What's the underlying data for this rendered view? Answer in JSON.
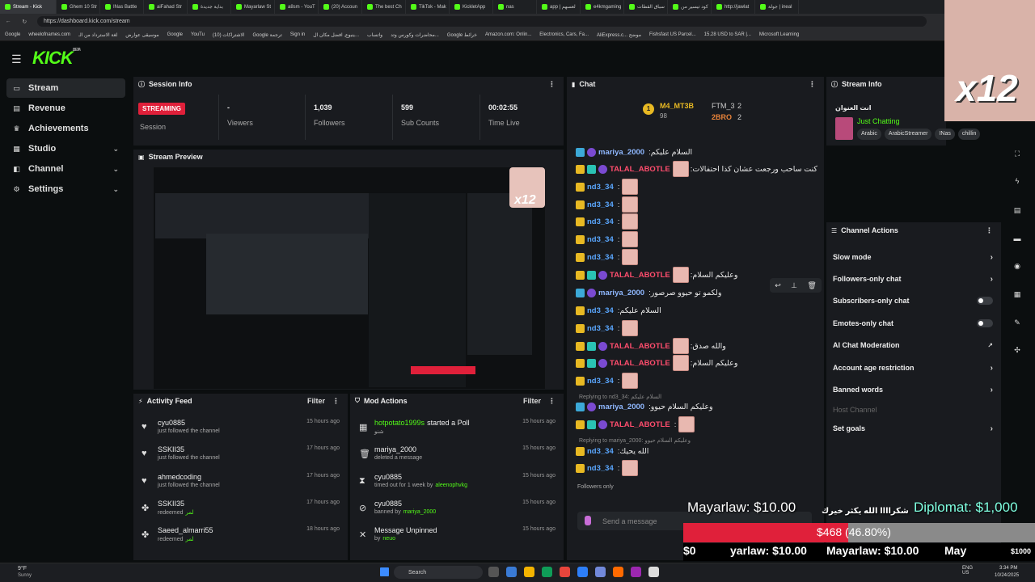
{
  "browser": {
    "tabs": [
      "Stream - Kick",
      "Ghem 10 Str",
      "INas Battle",
      "aiFahad Str",
      "بداية جديدة",
      "Mayarlaw St",
      "a8sm - YouT",
      "(20) Accoun",
      "The best Ch",
      "TikTok - Mak",
      "KickletApp",
      "nas",
      "app | لعسهم",
      "e4kmgaming",
      "سباق القطات",
      "كود تيسير من",
      "http://jawlat",
      "جولة | ineal"
    ],
    "url": "https://dashboard.kick.com/stream",
    "bookmarks": [
      "Google",
      "wheelofnames.com",
      "لغة الاسترداد من الـ",
      "موسيقى عوارض",
      "Google",
      "YouTu",
      "الاشتراكات (10)",
      "Google ترجمة",
      "Sign in",
      "ينبوع, افضل مكان ال...",
      "واتساب",
      "محاضرات وكورس وتد...",
      "Google خرائط",
      "Amazon.com: Onlin...",
      "Electronics, Cars, Fa...",
      "AliExpress.c... موضح",
      "Fishsfast US Parcel...",
      "15.28 USD to SAR |...",
      "Microsoft Learning"
    ]
  },
  "brand": {
    "logo": "KICK",
    "beta": "BETA"
  },
  "sidebar": {
    "items": [
      {
        "label": "Stream",
        "icon": "stream-icon"
      },
      {
        "label": "Revenue",
        "icon": "revenue-icon"
      },
      {
        "label": "Achievements",
        "icon": "trophy-icon"
      },
      {
        "label": "Studio",
        "icon": "studio-icon"
      },
      {
        "label": "Channel",
        "icon": "channel-icon"
      },
      {
        "label": "Settings",
        "icon": "gear-icon"
      }
    ]
  },
  "session": {
    "title": "Session Info",
    "status": "STREAMING",
    "status_label": "Session",
    "viewers": "-",
    "viewers_label": "Viewers",
    "followers": "1,039",
    "followers_label": "Followers",
    "subs": "599",
    "subs_label": "Sub Counts",
    "time": "00:02:55",
    "time_label": "Time Live"
  },
  "preview": {
    "title": "Stream Preview"
  },
  "activity": {
    "title": "Activity Feed",
    "filter": "Filter",
    "rows": [
      {
        "name": "cyu0885",
        "sub": "just followed the channel",
        "time": "15 hours ago",
        "icon": "heart-icon"
      },
      {
        "name": "SSKII35",
        "sub": "just followed the channel",
        "time": "17 hours ago",
        "icon": "heart-icon"
      },
      {
        "name": "ahmedcoding",
        "sub": "just followed the channel",
        "time": "17 hours ago",
        "icon": "heart-icon"
      },
      {
        "name": "SSKII35",
        "sub": "redeemed",
        "sub_extra": "لمر",
        "time": "17 hours ago",
        "icon": "redeem-icon"
      },
      {
        "name": "Saeed_almarri55",
        "sub": "redeemed",
        "sub_extra": "لمر",
        "time": "18 hours ago",
        "icon": "redeem-icon"
      }
    ]
  },
  "mod": {
    "title": "Mod Actions",
    "filter": "Filter",
    "rows": [
      {
        "name": "hotpotato1999s",
        "action": "started a Poll",
        "sub": "شنو",
        "time": "15 hours ago",
        "icon": "poll-icon"
      },
      {
        "name": "mariya_2000",
        "action": "",
        "sub": "deleted a message",
        "time": "15 hours ago",
        "icon": "trash-icon"
      },
      {
        "name": "cyu0885",
        "action": "",
        "sub": "timed out for 1 week by",
        "by": "aleenophvkg",
        "time": "15 hours ago",
        "icon": "hourglass-icon"
      },
      {
        "name": "cyu0885",
        "action": "",
        "sub": "banned by",
        "by": "mariya_2000",
        "time": "15 hours ago",
        "icon": "ban-icon"
      },
      {
        "name": "Message Unpinned",
        "action": "",
        "sub": "by",
        "by": "neuo",
        "time": "15 hours ago",
        "icon": "unpin-icon"
      }
    ]
  },
  "chat": {
    "title": "Chat",
    "top_gifters": [
      {
        "name": "M4_MT3B",
        "count": "98",
        "color": "#e8b923"
      },
      {
        "name": "FTM_3",
        "count": "2",
        "color": "#ccc"
      },
      {
        "name": "2BRO",
        "count": "2",
        "color": "#e8833a"
      }
    ],
    "messages": [
      {
        "user": "mariya_2000",
        "color": "#8fb8ff",
        "badges": [
          "bblue",
          "bpurp"
        ],
        "text": ":السلام عليكم",
        "emote": false
      },
      {
        "user": "TALAL_ABOTLE",
        "color": "#ff4d6d",
        "badges": [
          "bcrown",
          "bteal",
          "bpurp"
        ],
        "text": ":كنت ساحب ورجعت عشان كذا احتفالات",
        "emote": true
      },
      {
        "user": "nd3_34",
        "color": "#5aa7ff",
        "badges": [
          "bcrown"
        ],
        "text": ":",
        "emote": true
      },
      {
        "user": "nd3_34",
        "color": "#5aa7ff",
        "badges": [
          "bcrown"
        ],
        "text": ":",
        "emote": true
      },
      {
        "user": "nd3_34",
        "color": "#5aa7ff",
        "badges": [
          "bcrown"
        ],
        "text": ":",
        "emote": true
      },
      {
        "user": "nd3_34",
        "color": "#5aa7ff",
        "badges": [
          "bcrown"
        ],
        "text": ":",
        "emote": true
      },
      {
        "user": "nd3_34",
        "color": "#5aa7ff",
        "badges": [
          "bcrown"
        ],
        "text": ":",
        "emote": true
      },
      {
        "user": "TALAL_ABOTLE",
        "color": "#ff4d6d",
        "badges": [
          "bcrown",
          "bteal",
          "bpurp"
        ],
        "text": ":وعليكم السلام",
        "emote": true
      },
      {
        "user": "mariya_2000",
        "color": "#8fb8ff",
        "badges": [
          "bblue",
          "bpurp"
        ],
        "text": ":ولكمو تو حيوو صرصور",
        "emote": false
      },
      {
        "user": "nd3_34",
        "color": "#5aa7ff",
        "badges": [
          "bcrown"
        ],
        "text": ":السلام عليكم",
        "emote": false
      },
      {
        "user": "nd3_34",
        "color": "#5aa7ff",
        "badges": [
          "bcrown"
        ],
        "text": ":",
        "emote": true
      },
      {
        "user": "TALAL_ABOTLE",
        "color": "#ff4d6d",
        "badges": [
          "bcrown",
          "bteal",
          "bpurp"
        ],
        "text": ":والله صدق",
        "emote": true
      },
      {
        "user": "TALAL_ABOTLE",
        "color": "#ff4d6d",
        "badges": [
          "bcrown",
          "bteal",
          "bpurp"
        ],
        "text": ":وعليكم السلام",
        "emote": true
      },
      {
        "user": "nd3_34",
        "color": "#5aa7ff",
        "badges": [
          "bcrown"
        ],
        "text": ":",
        "emote": true
      },
      {
        "user": "mariya_2000",
        "color": "#8fb8ff",
        "badges": [
          "bblue",
          "bpurp"
        ],
        "text": ":وعليكم السلام حيوو",
        "emote": false
      },
      {
        "user": "TALAL_ABOTLE",
        "color": "#ff4d6d",
        "badges": [
          "bcrown",
          "bteal",
          "bpurp"
        ],
        "text": ":",
        "emote": true
      },
      {
        "user": "nd3_34",
        "color": "#5aa7ff",
        "badges": [
          "bcrown"
        ],
        "text": ":الله يحيك",
        "emote": false
      },
      {
        "user": "nd3_34",
        "color": "#5aa7ff",
        "badges": [
          "bcrown"
        ],
        "text": ":",
        "emote": true
      }
    ],
    "replies": [
      "Replying to nd3_34: السلام عليكم",
      "Replying to mariya_2000: وعليكم السلام حيوو"
    ],
    "followers_only": "Followers only",
    "placeholder": "Send a message"
  },
  "stream_info": {
    "title": "Stream Info",
    "stream_title": "انت العنوان",
    "category": "Just Chatting",
    "tags": [
      "Arabic",
      "ArabicStreamer",
      "INas",
      "chillin"
    ]
  },
  "channel_actions": {
    "title": "Channel Actions",
    "items": [
      {
        "label": "Slow mode",
        "kind": "chevron"
      },
      {
        "label": "Followers-only chat",
        "kind": "chevron"
      },
      {
        "label": "Subscribers-only chat",
        "kind": "toggle"
      },
      {
        "label": "Emotes-only chat",
        "kind": "toggle"
      },
      {
        "label": "AI Chat Moderation",
        "kind": "external"
      },
      {
        "label": "Account age restriction",
        "kind": "chevron"
      },
      {
        "label": "Banned words",
        "kind": "chevron"
      },
      {
        "label": "Host Channel",
        "kind": "disabled"
      },
      {
        "label": "Set goals",
        "kind": "chevron"
      }
    ]
  },
  "overlay": {
    "badge": "x12",
    "donation1": "Mayarlaw: $10.00",
    "donation2": "Diplomat: $1,000",
    "arabic_msg": "شكراااا الله يكثر خيرك",
    "progress_label": "$468",
    "progress_pct": "(46.80%)",
    "progress_value": 0.468,
    "bottom_left": "$0",
    "ticker": [
      "yarlaw: $10.00",
      "Mayarlaw: $10.00",
      "May"
    ],
    "bottom_right": "$1000"
  },
  "taskbar": {
    "weather_temp": "9°F",
    "weather_text": "Sunny",
    "search": "Search",
    "lang": "ENG US",
    "time": "3:34 PM",
    "date": "10/24/2025"
  },
  "colors": {
    "accent": "#53fc18",
    "streaming": "#e0203a",
    "panel": "#191b1f",
    "bg": "#0b0e0f"
  }
}
